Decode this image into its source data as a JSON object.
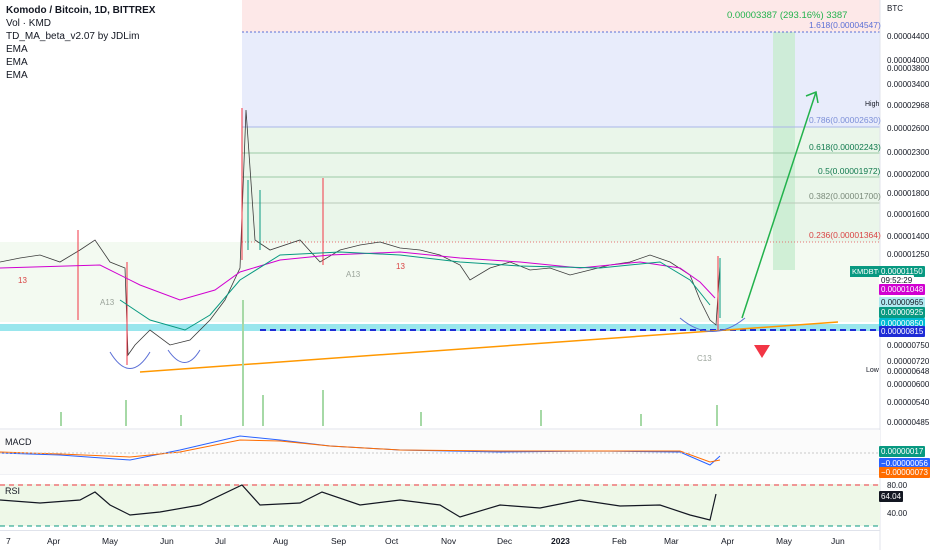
{
  "legend": {
    "title": "Komodo / Bitcoin, 1D, BITTREX",
    "indicators": [
      "Vol · KMD",
      "TD_MA_beta_v2.07 by JDLim",
      "EMA",
      "EMA",
      "EMA"
    ]
  },
  "currency": "BTC",
  "target_label": "0.00003387 (293.16%) 3387",
  "fib_levels": [
    {
      "label": "1.618(0.00004547)",
      "color": "#5b6fd6"
    },
    {
      "label": "0.786(0.00002630)",
      "color": "#7c8fd8"
    },
    {
      "label": "0.618(0.00002243)",
      "color": "#117a4e"
    },
    {
      "label": "0.5(0.00001972)",
      "color": "#117a4e"
    },
    {
      "label": "0.382(0.00001700)",
      "color": "#7a8a7a"
    },
    {
      "label": "0.236(0.00001364)",
      "color": "#d94444"
    }
  ],
  "price_scale": [
    "0.00004400",
    "0.00004000",
    "0.00003800",
    "0.00003400",
    "0.00002968",
    "0.00002600",
    "0.00002300",
    "0.00002000",
    "0.00001800",
    "0.00001600",
    "0.00001400",
    "0.00001250",
    "0.00000750",
    "0.00000720",
    "0.00000648",
    "0.00000600",
    "0.00000540",
    "0.00000485"
  ],
  "high_label": "High",
  "high_value": "0.00002968",
  "low_label": "Low",
  "low_value": "0.00000648",
  "ticker": "KMDBTC",
  "tags": [
    {
      "text": "0.00001150",
      "color": "#089981"
    },
    {
      "text": "09:52:29",
      "color": "#089981"
    },
    {
      "text": "0.00001048",
      "color": "#d100d1"
    },
    {
      "text": "0.00000965",
      "color": "#b2ebf2"
    },
    {
      "text": "0.00000925",
      "color": "#089981"
    },
    {
      "text": "0.00000850",
      "color": "#00bcd4"
    },
    {
      "text": "0.00000815",
      "color": "#1e2bd6"
    }
  ],
  "macd_label": "MACD",
  "macd_tags": [
    {
      "text": "0.00000017",
      "color": "#089981"
    },
    {
      "text": "−0.00000056",
      "color": "#2962ff"
    },
    {
      "text": "−0.00000073",
      "color": "#ff6d00"
    }
  ],
  "rsi_label": "RSI",
  "rsi_scale": [
    "80.00",
    "64.04",
    "40.00"
  ],
  "x_labels": [
    "7",
    "Apr",
    "May",
    "Jun",
    "Jul",
    "Aug",
    "Sep",
    "Oct",
    "Nov",
    "Dec",
    "2023",
    "Feb",
    "Mar",
    "Apr",
    "May",
    "Jun"
  ],
  "annotations": [
    "A13",
    "13",
    "A13",
    "13",
    "C13"
  ],
  "colors": {
    "up": "#089981",
    "down": "#f23645",
    "ema_fast": "#2962ff",
    "ema_mid": "#d100d1",
    "support": "#00bcd4",
    "trend": "#ff9800",
    "arrow": "#22b24c"
  }
}
